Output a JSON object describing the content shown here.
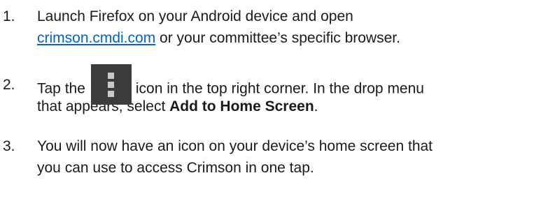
{
  "steps": [
    {
      "number": "1.",
      "line1": "Launch Firefox on your Android device and open",
      "link": "crimson.cmdi.com",
      "line2_rest": " or your committee’s specific browser."
    },
    {
      "number": "2.",
      "before_icon": "Tap the",
      "icon": "menu-overflow-icon",
      "after_icon": "icon in the top right corner.  In the drop menu",
      "line2_start": "that appears, select ",
      "bold": "Add to Home Screen",
      "line2_end": "."
    },
    {
      "number": "3.",
      "line1": "You will now have an icon on your device’s home screen that",
      "line2": "you can use to access Crimson in one tap."
    }
  ]
}
